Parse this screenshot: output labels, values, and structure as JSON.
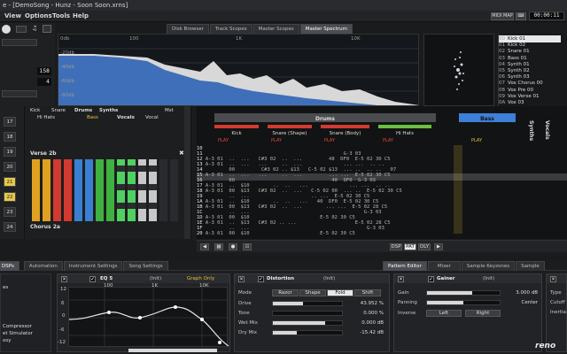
{
  "window": {
    "title": "e - [DemoSong - Hunz - Soon Soon.xrns]"
  },
  "menu": [
    "View",
    "Options",
    "Tools",
    "Help"
  ],
  "transport": {
    "midi_map": "MIDI MAP",
    "time": "00:00:11"
  },
  "upper_tabs": [
    "Disk Browser",
    "Track Scopes",
    "Master Scopes",
    "Master Spectrum"
  ],
  "upper_tab_active": 3,
  "left_values": [
    {
      "label": "",
      "value": "158"
    },
    {
      "label": "",
      "value": "4"
    }
  ],
  "spectrum": {
    "db_labels": [
      "0db",
      "-20db",
      "-40db",
      "-60db",
      "-80db"
    ],
    "freq_labels": [
      "100",
      "1K",
      "10K"
    ]
  },
  "instruments": [
    {
      "n": "00",
      "name": "Kick 01"
    },
    {
      "n": "01",
      "name": "Kick 02"
    },
    {
      "n": "02",
      "name": "Snare 01"
    },
    {
      "n": "03",
      "name": "Bass 01"
    },
    {
      "n": "04",
      "name": "Synth 01"
    },
    {
      "n": "05",
      "name": "Synth 02"
    },
    {
      "n": "06",
      "name": "Synth 03"
    },
    {
      "n": "07",
      "name": "Vox Chorus 00"
    },
    {
      "n": "08",
      "name": "Vox Pre 00"
    },
    {
      "n": "09",
      "name": "Vox Verse 01"
    },
    {
      "n": "0A",
      "name": "Vox 03"
    }
  ],
  "instrument_selected": 0,
  "pattern_sequence": [
    "17",
    "18",
    "19",
    "20",
    "21",
    "22",
    "23",
    "24"
  ],
  "matrix": {
    "groups": [
      "Drums",
      "Synths"
    ],
    "tracks": [
      "Kick",
      "Snare",
      "Hi Hats",
      "Bass",
      "Vocals",
      "Vocal",
      "Mst"
    ],
    "sections": [
      "Verse 2b",
      "Chorus 2a"
    ],
    "cell_colors": [
      "#e0a020",
      "#d03a30",
      "#3a7fd0",
      "#40b040",
      "#50d060",
      "#c8c8c8"
    ]
  },
  "pattern_editor": {
    "group": "Drums",
    "tracks": [
      "Kick",
      "Snare (Shape)",
      "Snare (Body)",
      "Hi Hats",
      "Bass"
    ],
    "side_tracks": [
      "Synths",
      "Vocals"
    ],
    "play_label": "PLAY",
    "rows": [
      {
        "n": "10",
        "text": "                                                    "
      },
      {
        "n": "11",
        "text": "                                                G-3 03"
      },
      {
        "n": "12",
        "text": " A-3 01  ..  ...   C#3 02  ..  ...         48  DF0  E-5 02 30 C5"
      },
      {
        "n": "13",
        "text": " A-3 01  ..  ...   ...     ..  ...              ... ...  .. .."
      },
      {
        "n": "14",
        "text": "         00         C#3 02 .. $13   C-5 02 $13  ... ..  .. ..   07"
      },
      {
        "n": "15",
        "text": " A-3 01  ..  ...   ...     ..  ...         ... ...  E-5 02 30 C5"
      },
      {
        "n": "16",
        "text": "         00                                 40  DF0  G-3 03"
      },
      {
        "n": "17",
        "text": " A-3 01  ..  $10        ..  ..   ...              ... ...  .. .."
      },
      {
        "n": "18",
        "text": " A-3 01  00  $13   C#3 02  ..  ...   C-5 02 00  ... ..  E-5 02 30 C5"
      },
      {
        "n": "19",
        "text": "         ..  ...                     .. ...  E-5 02 30 C5"
      },
      {
        "n": "1A",
        "text": " A-3 01  ..  $10        ..  ..   ...   40  DF0  E-5 02 30 C5"
      },
      {
        "n": "1B",
        "text": " A-3 01  00  $13   C#3 02  ..  ...        ... ...  E-5 02 28 C5"
      },
      {
        "n": "1C",
        "text": "         ..  ...                                       G-3 03"
      },
      {
        "n": "1D",
        "text": " A-3 01  00  $10                        E-5 02 30 C5"
      },
      {
        "n": "1E",
        "text": " A-3 01  ..  $13   C#3 02 .. ...                    E-5 02 28 C5"
      },
      {
        "n": "1F",
        "text": "         ..  ...                                        G-3 03"
      },
      {
        "n": "20",
        "text": " A-3 01  00  $10                        E-5 02 30 C5"
      }
    ]
  },
  "editor_footer": {
    "buttons": [
      "DSP",
      "PAT",
      "DLY"
    ]
  },
  "lower_tabs_left": [
    "DSPs",
    "Automation",
    "Instrument Settings",
    "Song Settings"
  ],
  "lower_tabs_right": [
    "Pattern Editor",
    "Mixer",
    "Sample Keyzones",
    "Sample"
  ],
  "lower_tab_active": 0,
  "dsp_list": [
    "es",
    "Compressor",
    "et Simulator",
    "osy"
  ],
  "eq5": {
    "title": "EQ 5",
    "preset": "(Init)",
    "mode": "Graph Only",
    "gain_labels": [
      "12",
      "6",
      "0",
      "-6",
      "-12"
    ],
    "freq_labels": [
      "100",
      "1K",
      "10K"
    ]
  },
  "distortion": {
    "title": "Distortion",
    "preset": "(Init)",
    "mode_label": "Mode",
    "modes": [
      "Razor",
      "Shape",
      "Fold",
      "Shift"
    ],
    "mode_active": 2,
    "params": [
      {
        "label": "Drive",
        "value": "43.952 %",
        "fill": 0.44
      },
      {
        "label": "Tone",
        "value": "0.000 %",
        "fill": 0.0
      },
      {
        "label": "Wet Mix",
        "value": "0.000 dB",
        "fill": 0.75
      },
      {
        "label": "Dry Mix",
        "value": "-15.42 dB",
        "fill": 0.35
      }
    ]
  },
  "gainer": {
    "title": "Gainer",
    "preset": "(Init)",
    "params": [
      {
        "label": "Gain",
        "value": "3.000 dB",
        "fill": 0.62
      },
      {
        "label": "Panning",
        "value": "Center",
        "fill": 0.5
      }
    ],
    "inverse_label": "Inverse",
    "inverse_buttons": [
      "Left",
      "Right"
    ]
  },
  "right_device": {
    "labels": [
      "Type",
      "Cutoff",
      "Inertia"
    ]
  },
  "logo": "reno"
}
